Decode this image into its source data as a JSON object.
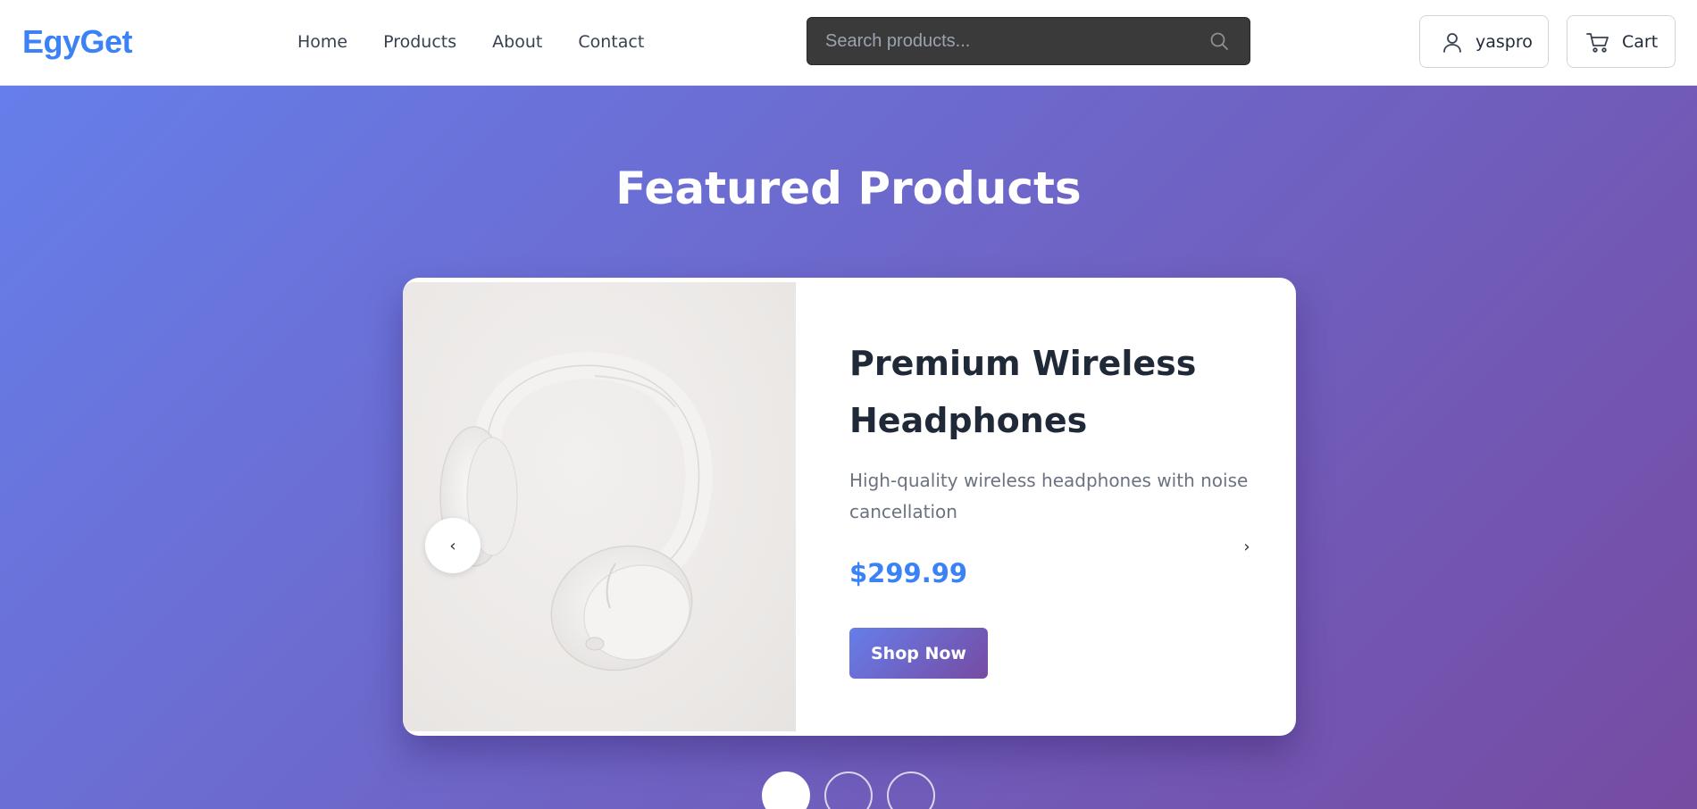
{
  "header": {
    "logo": "EgyGet",
    "nav": [
      {
        "label": "Home"
      },
      {
        "label": "Products"
      },
      {
        "label": "About"
      },
      {
        "label": "Contact"
      }
    ],
    "search": {
      "placeholder": "Search products...",
      "value": ""
    },
    "user_label": "yaspro",
    "cart_label": "Cart"
  },
  "hero": {
    "title": "Featured Products",
    "slide": {
      "product_name": "Premium Wireless Headphones",
      "description": "High-quality wireless headphones with noise cancellation",
      "price": "$299.99",
      "cta": "Shop Now"
    },
    "prev_arrow": "‹",
    "next_arrow": "›",
    "slide_count": 3,
    "active_slide": 1
  },
  "colors": {
    "brand": "#3b82f6",
    "gradient_start": "#667eea",
    "gradient_end": "#764ba2",
    "search_bg": "#3a3a3a"
  },
  "icons": {
    "search": "search-icon",
    "user": "user-icon",
    "cart": "cart-icon",
    "prev": "chevron-left-icon",
    "next": "chevron-right-icon"
  }
}
